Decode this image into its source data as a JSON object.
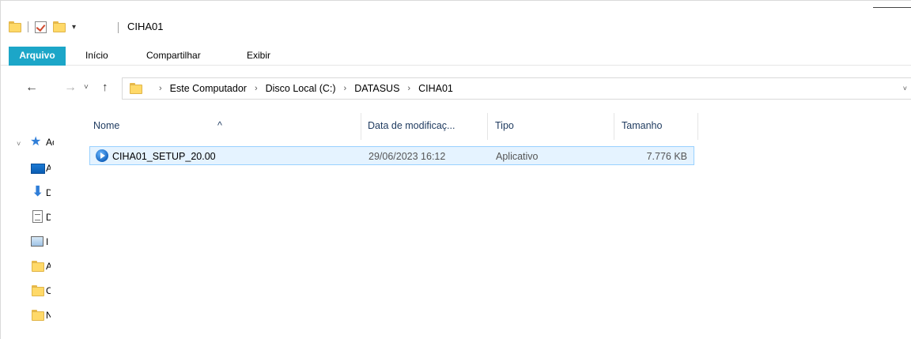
{
  "window": {
    "title": "CIHA01"
  },
  "ribbon": {
    "tabs": [
      "Arquivo",
      "Início",
      "Compartilhar",
      "Exibir"
    ]
  },
  "address": {
    "crumbs": [
      "Este Computador",
      "Disco Local (C:)",
      "DATASUS",
      "CIHA01"
    ]
  },
  "sidebar": {
    "items": [
      {
        "label": "Ac",
        "icon": "star-icon"
      },
      {
        "label": "A",
        "icon": "desktop-icon"
      },
      {
        "label": "D",
        "icon": "downloads-icon"
      },
      {
        "label": "D",
        "icon": "documents-icon"
      },
      {
        "label": "I",
        "icon": "pictures-icon"
      },
      {
        "label": "A",
        "icon": "folder-icon"
      },
      {
        "label": "C",
        "icon": "folder-icon"
      },
      {
        "label": "N",
        "icon": "folder-icon"
      }
    ]
  },
  "columns": {
    "name": "Nome",
    "date": "Data de modificaç...",
    "type": "Tipo",
    "size": "Tamanho"
  },
  "files": [
    {
      "name": "CIHA01_SETUP_20.00",
      "date": "29/06/2023 16:12",
      "type": "Aplicativo",
      "size": "7.776 KB"
    }
  ],
  "colors": {
    "file_tab": "#1ca6c8",
    "selection": "#e5f3ff",
    "selection_border": "#99d1ff"
  }
}
